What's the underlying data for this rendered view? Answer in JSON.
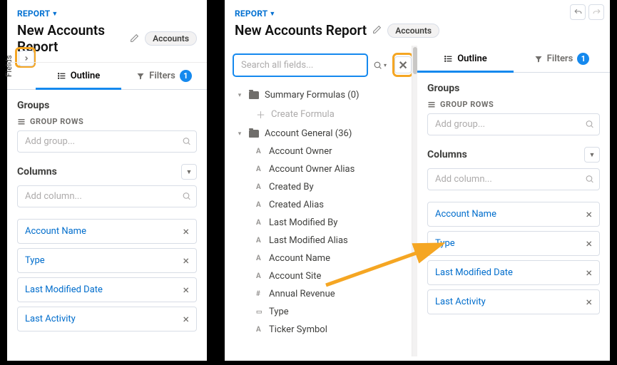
{
  "left": {
    "crumb": "REPORT",
    "title": "New Accounts Report",
    "badge": "Accounts",
    "tabs": {
      "outline": "Outline",
      "filters": "Filters",
      "filter_count": "1"
    },
    "fields_label": "Fields",
    "groups": {
      "heading": "Groups",
      "meta": "GROUP ROWS",
      "placeholder": "Add group..."
    },
    "columns": {
      "heading": "Columns",
      "placeholder": "Add column...",
      "items": [
        {
          "label": "Account Name"
        },
        {
          "label": "Type"
        },
        {
          "label": "Last Modified Date"
        },
        {
          "label": "Last Activity"
        }
      ]
    }
  },
  "right": {
    "crumb": "REPORT",
    "title": "New Accounts Report",
    "badge": "Accounts",
    "tabs": {
      "outline": "Outline",
      "filters": "Filters",
      "filter_count": "1"
    },
    "search": {
      "placeholder": "Search all fields..."
    },
    "tree": {
      "group1": {
        "label": "Summary Formulas (0)",
        "action": "Create Formula"
      },
      "group2": {
        "label": "Account General (36)",
        "fields": [
          {
            "t": "A",
            "label": "Account Owner"
          },
          {
            "t": "A",
            "label": "Account Owner Alias"
          },
          {
            "t": "A",
            "label": "Created By"
          },
          {
            "t": "A",
            "label": "Created Alias"
          },
          {
            "t": "A",
            "label": "Last Modified By"
          },
          {
            "t": "A",
            "label": "Last Modified Alias"
          },
          {
            "t": "A",
            "label": "Account Name"
          },
          {
            "t": "A",
            "label": "Account Site"
          },
          {
            "t": "#",
            "label": "Annual Revenue"
          },
          {
            "t": "▭",
            "label": "Type"
          },
          {
            "t": "A",
            "label": "Ticker Symbol"
          }
        ]
      }
    },
    "groups": {
      "heading": "Groups",
      "meta": "GROUP ROWS",
      "placeholder": "Add group..."
    },
    "columns": {
      "heading": "Columns",
      "placeholder": "Add column...",
      "items": [
        {
          "label": "Account Name"
        },
        {
          "label": "Type"
        },
        {
          "label": "Last Modified Date"
        },
        {
          "label": "Last Activity"
        }
      ]
    }
  }
}
